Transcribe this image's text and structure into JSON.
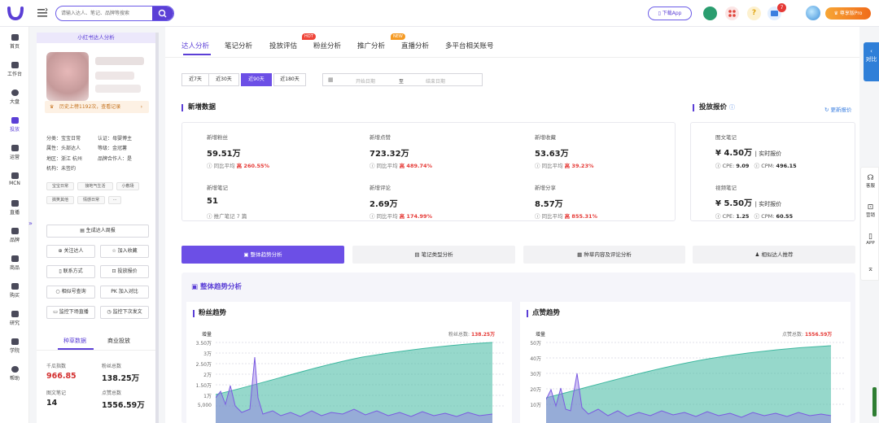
{
  "search": {
    "placeholder": "请输入达人、笔记、品牌等搜索"
  },
  "header": {
    "download_label": "下载App",
    "notify_count": "7",
    "pro_label": "尊享版Pro"
  },
  "nav": [
    {
      "id": "home",
      "label": "首页"
    },
    {
      "id": "workbench",
      "label": "工作台"
    },
    {
      "id": "dashboard",
      "label": "大盘"
    },
    {
      "id": "ads",
      "label": "投放"
    },
    {
      "id": "ops",
      "label": "运营"
    },
    {
      "id": "mcn",
      "label": "MCN"
    },
    {
      "id": "live",
      "label": "直播"
    },
    {
      "id": "brand",
      "label": "品牌"
    },
    {
      "id": "goods",
      "label": "商品"
    },
    {
      "id": "buy",
      "label": "购买"
    },
    {
      "id": "research",
      "label": "研究"
    },
    {
      "id": "academy",
      "label": "学院"
    },
    {
      "id": "help",
      "label": "帮助"
    }
  ],
  "profile": {
    "title": "小红书达人分析",
    "history": "历史上榜1192次，查看记录",
    "category": "分类：宝宝日常",
    "certify": "认证：母婴博主",
    "attr": "属性：头部达人",
    "level": "等级：金冠薯",
    "region": "地区：浙江 杭州",
    "brand_partner": "品牌合作人：是",
    "org": "机构：未签约",
    "tags": [
      "宝宝日常",
      "接地气生活",
      "小敷场",
      "搞笑其他",
      "情感日常",
      "···"
    ],
    "buttons": {
      "report": "生成达人周报",
      "follow": "关注达人",
      "favorite": "加入收藏",
      "contact": "联系方式",
      "quote": "投放报价",
      "similar": "相似号查询",
      "compare": "PK 加入对比",
      "monitor_live": "监控下场直播",
      "monitor_post": "监控下次发文"
    },
    "tabs": [
      "种草数据",
      "商业投放"
    ],
    "stats": [
      {
        "label": "千瓜指数",
        "value": "966.85"
      },
      {
        "label": "粉丝总数",
        "value": "138.25万"
      },
      {
        "label": "图文笔记",
        "value": "14"
      },
      {
        "label": "点赞总数",
        "value": "1556.59万"
      }
    ]
  },
  "main": {
    "tabs": [
      "达人分析",
      "笔记分析",
      "投放评估",
      "粉丝分析",
      "推广分析",
      "直播分析",
      "多平台相关账号"
    ],
    "badges": {
      "hot": "HOT",
      "new": "NEW"
    },
    "ranges": [
      "近7天",
      "近30天",
      "近90天",
      "近180天"
    ],
    "date_start": "开始日期",
    "date_sep": "至",
    "date_end": "结束日期",
    "new_data_title": "新增数据",
    "metrics": [
      {
        "label": "新增粉丝",
        "value": "59.51万",
        "cmp": "同比平均",
        "trend": "高 260.55%"
      },
      {
        "label": "新增点赞",
        "value": "723.32万",
        "cmp": "同比平均",
        "trend": "高 489.74%"
      },
      {
        "label": "新增收藏",
        "value": "53.63万",
        "cmp": "同比平均",
        "trend": "高 39.23%"
      },
      {
        "label": "新增笔记",
        "value": "51",
        "cmp": "推广笔记 7 篇",
        "trend": ""
      },
      {
        "label": "新增评论",
        "value": "2.69万",
        "cmp": "同比平均",
        "trend": "高 174.99%"
      },
      {
        "label": "新增分享",
        "value": "8.57万",
        "cmp": "同比平均",
        "trend": "高 855.31%"
      }
    ],
    "price": {
      "title": "投放报价",
      "update": "更新报价",
      "items": [
        {
          "label": "图文笔记",
          "price": "¥ 4.50万",
          "tag": "实时报价",
          "cpe": "CPE: ",
          "cpe_v": "9.09",
          "cpm": "CPM: ",
          "cpm_v": "496.15"
        },
        {
          "label": "视频笔记",
          "price": "¥ 5.50万",
          "tag": "实时报价",
          "cpe": "CPE: ",
          "cpe_v": "1.25",
          "cpm": "CPM: ",
          "cpm_v": "60.55"
        }
      ]
    },
    "analysis_tabs": [
      "整体趋势分析",
      "笔记类型分析",
      "种草内容及评论分析",
      "相似达人推荐"
    ],
    "trend_title": "整体趋势分析",
    "fans_chart": {
      "title": "粉丝趋势",
      "unit": "增量",
      "total_label": "粉丝总数: ",
      "total": "138.25万",
      "yticks": [
        "3.50万",
        "3万",
        "2.50万",
        "2万",
        "1.50万",
        "1万",
        "5,000"
      ]
    },
    "likes_chart": {
      "title": "点赞趋势",
      "unit": "增量",
      "total_label": "点赞总数: ",
      "total": "1556.59万",
      "yticks": [
        "50万",
        "40万",
        "30万",
        "20万",
        "10万"
      ]
    }
  },
  "right_tools": {
    "compare": "对比",
    "service": "客服",
    "marketing": "营销",
    "app": "APP"
  },
  "colors": {
    "accent": "#5b3fd6",
    "danger": "#e53935",
    "teal": "#3fb8a0"
  }
}
